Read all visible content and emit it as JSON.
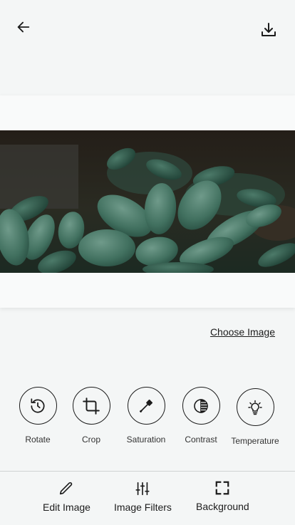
{
  "header": {
    "back_icon": "arrow-left-icon",
    "download_icon": "download-icon"
  },
  "image": {
    "alt": "Succulent plant photo"
  },
  "choose_image_label": "Choose Image",
  "tools": [
    {
      "label": "Rotate",
      "icon": "rotate-icon"
    },
    {
      "label": "Crop",
      "icon": "crop-icon"
    },
    {
      "label": "Saturation",
      "icon": "eyedropper-icon"
    },
    {
      "label": "Contrast",
      "icon": "contrast-icon"
    },
    {
      "label": "Temperature",
      "icon": "temperature-icon"
    }
  ],
  "bottom_nav": [
    {
      "label": "Edit Image",
      "icon": "pencil-icon"
    },
    {
      "label": "Image Filters",
      "icon": "sliders-icon"
    },
    {
      "label": "Background",
      "icon": "fullscreen-icon"
    }
  ]
}
